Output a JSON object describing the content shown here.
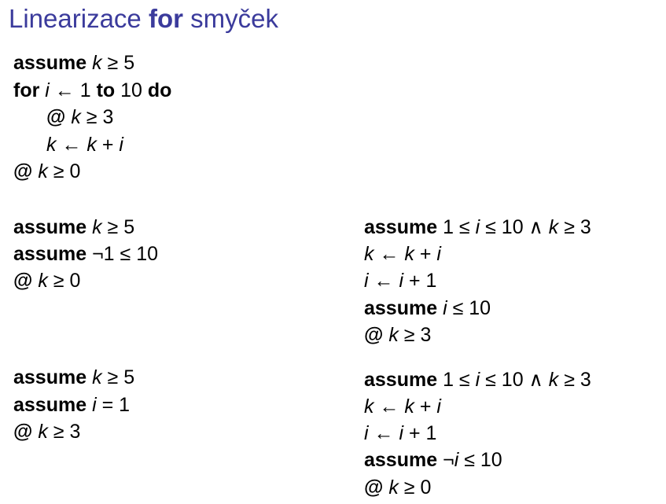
{
  "title": {
    "part1": "Linearizace ",
    "part2": "for",
    "part3": " smyček"
  },
  "blocks": {
    "original": [
      {
        "kw": "assume",
        "expr": "k ≥ 5"
      },
      {
        "kw": "for",
        "expr": "i ← 1 ",
        "kw2": "to",
        "expr2": " 10 ",
        "kw3": "do"
      },
      {
        "kw": "@",
        "expr": "k ≥ 3"
      },
      {
        "kw": "",
        "expr": "k ← k + i"
      },
      {
        "kw": "@",
        "expr": "k ≥ 0"
      }
    ],
    "skip": [
      {
        "kw": "assume",
        "expr": "k ≥ 5"
      },
      {
        "kw": "assume",
        "expr": "¬1 ≤ 10"
      },
      {
        "kw": "@",
        "expr": "k ≥ 0"
      }
    ],
    "enter": [
      {
        "kw": "assume",
        "expr": "k ≥ 5"
      },
      {
        "kw": "assume",
        "expr": "i = 1"
      },
      {
        "kw": "@",
        "expr": "k ≥ 3"
      }
    ],
    "iterate": [
      {
        "kw": "assume",
        "expr": "1 ≤ i ≤ 10 ∧ k ≥ 3"
      },
      {
        "kw": "",
        "expr": "k ← k + i"
      },
      {
        "kw": "",
        "expr": "i ← i + 1"
      },
      {
        "kw": "assume",
        "expr": "i ≤ 10"
      },
      {
        "kw": "@",
        "expr": "k ≥ 3"
      }
    ],
    "exit": [
      {
        "kw": "assume",
        "expr": "1 ≤ i ≤ 10 ∧ k ≥ 3"
      },
      {
        "kw": "",
        "expr": "k ← k + i"
      },
      {
        "kw": "",
        "expr": "i ← i + 1"
      },
      {
        "kw": "assume",
        "expr": "¬i ≤ 10"
      },
      {
        "kw": "@",
        "expr": "k ≥ 0"
      }
    ]
  }
}
